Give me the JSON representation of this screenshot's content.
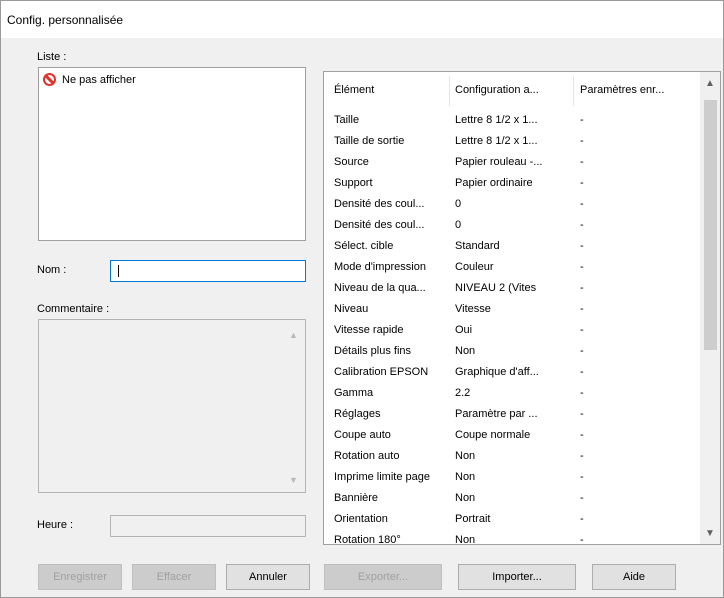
{
  "window": {
    "title": "Config. personnalisée"
  },
  "liste": {
    "label": "Liste :",
    "items": [
      {
        "label": "Ne pas afficher",
        "icon": "no-entry-icon"
      }
    ]
  },
  "nom": {
    "label": "Nom :",
    "value": ""
  },
  "commentaire": {
    "label": "Commentaire :",
    "value": ""
  },
  "heure": {
    "label": "Heure :",
    "value": ""
  },
  "table": {
    "columns": [
      "Élément",
      "Configuration a...",
      "Paramètres enr..."
    ],
    "rows": [
      [
        "Taille",
        "Lettre 8 1/2 x 1...",
        "-"
      ],
      [
        "Taille de sortie",
        "Lettre 8 1/2 x 1...",
        "-"
      ],
      [
        "Source",
        "Papier rouleau -...",
        "-"
      ],
      [
        "Support",
        "Papier ordinaire",
        "-"
      ],
      [
        "Densité des coul...",
        "0",
        "-"
      ],
      [
        "Densité des coul...",
        "0",
        "-"
      ],
      [
        "Sélect. cible",
        "Standard",
        "-"
      ],
      [
        "Mode d'impression",
        "Couleur",
        "-"
      ],
      [
        "Niveau de la qua...",
        "NIVEAU 2 (Vites",
        "-"
      ],
      [
        "Niveau",
        "Vitesse",
        "-"
      ],
      [
        "Vitesse rapide",
        "Oui",
        "-"
      ],
      [
        "Détails plus fins",
        "Non",
        "-"
      ],
      [
        "Calibration EPSON",
        "Graphique d'aff...",
        "-"
      ],
      [
        "Gamma",
        "2.2",
        "-"
      ],
      [
        "Réglages",
        "Paramètre par ...",
        "-"
      ],
      [
        "Coupe auto",
        "Coupe normale",
        "-"
      ],
      [
        "Rotation auto",
        "Non",
        "-"
      ],
      [
        "Imprime limite page",
        "Non",
        "-"
      ],
      [
        "Bannière",
        "Non",
        "-"
      ],
      [
        "Orientation",
        "Portrait",
        "-"
      ],
      [
        "Rotation 180°",
        "Non",
        "-"
      ]
    ]
  },
  "buttons": {
    "enregistrer": "Enregistrer",
    "effacer": "Effacer",
    "annuler": "Annuler",
    "exporter": "Exporter...",
    "importer": "Importer...",
    "aide": "Aide"
  }
}
